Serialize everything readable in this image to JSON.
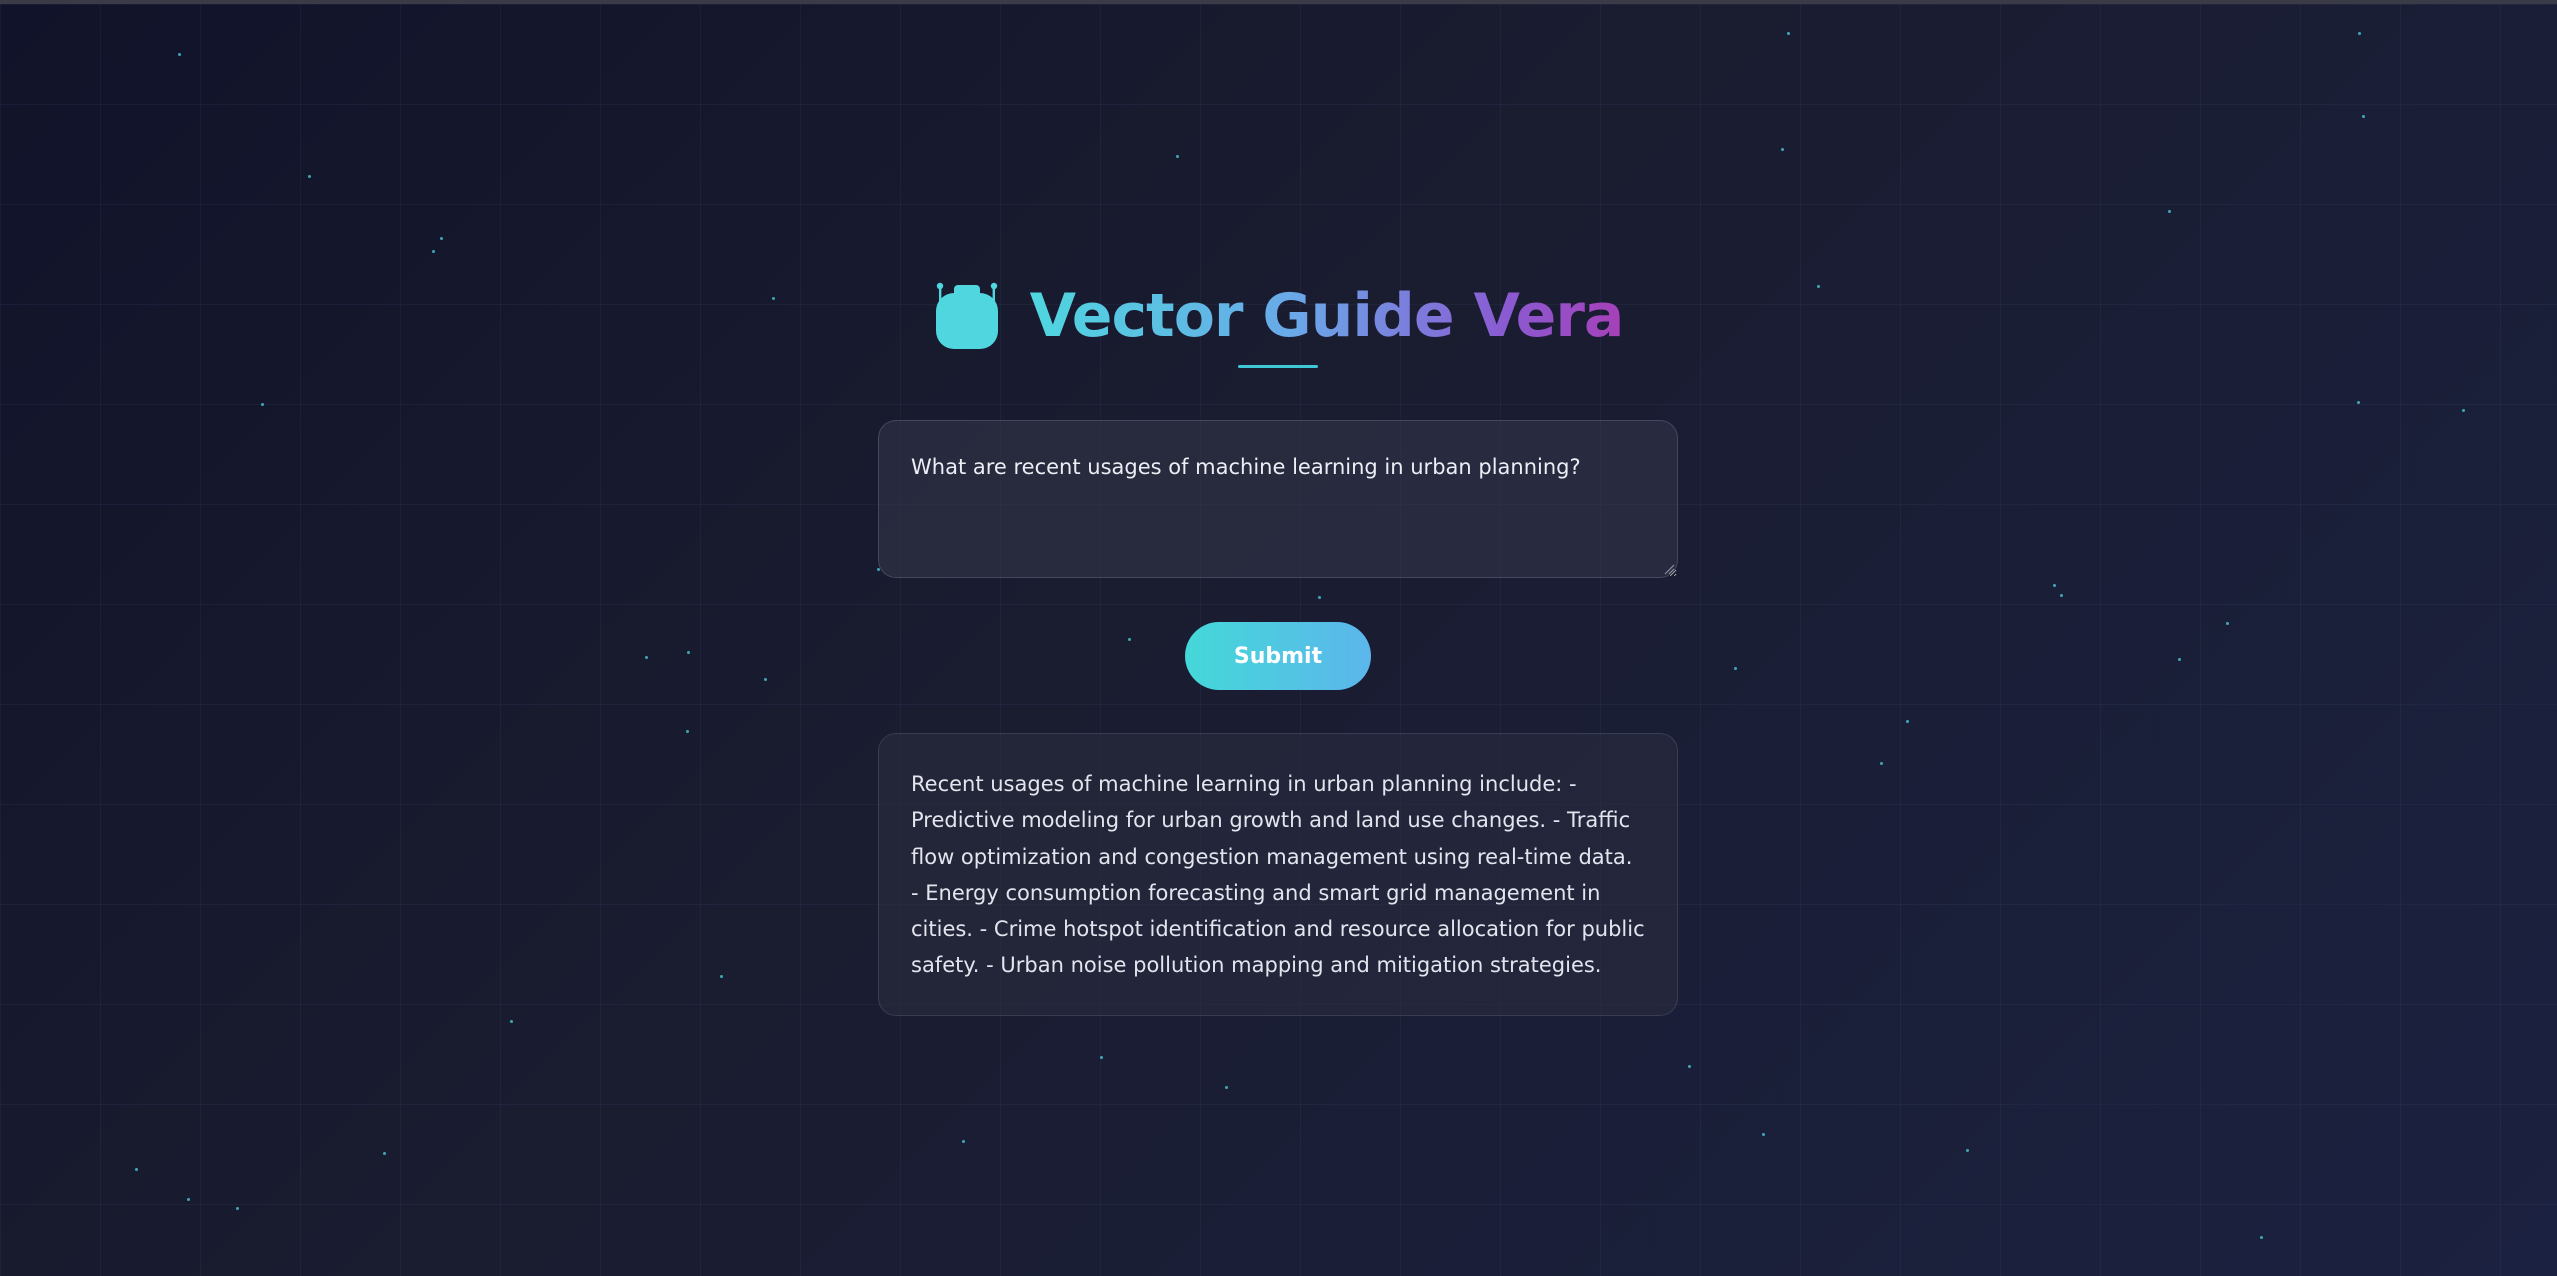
{
  "app": {
    "title": "Vector Guide Vera",
    "logo_icon": "robot-icon"
  },
  "query": {
    "value": "What are recent usages of machine learning in urban planning?",
    "placeholder": ""
  },
  "submit": {
    "label": "Submit"
  },
  "response": {
    "text": "Recent usages of machine learning in urban planning include: - Predictive modeling for urban growth and land use changes. - Traffic flow optimization and congestion management using real-time data. - Energy consumption forecasting and smart grid management in cities. - Crime hotspot identification and resource allocation for public safety. - Urban noise pollution mapping and mitigation strategies."
  },
  "colors": {
    "background_start": "#11132a",
    "background_end": "#1b2140",
    "accent_cyan": "#4fd6df",
    "accent_blue": "#5cb6ec",
    "accent_purple": "#a640b8",
    "particle": "#4fd6df"
  }
}
